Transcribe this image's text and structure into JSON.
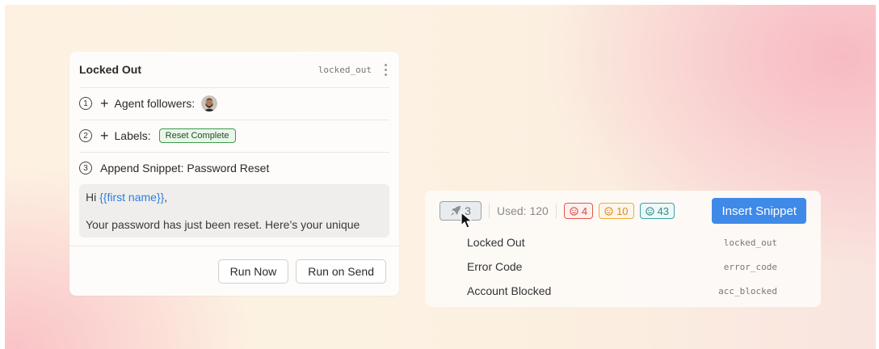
{
  "snippet_card": {
    "title": "Locked Out",
    "code": "locked_out",
    "steps": [
      {
        "num": "1",
        "text": "Agent followers:"
      },
      {
        "num": "2",
        "text": "Labels:",
        "label": "Reset Complete"
      },
      {
        "num": "3",
        "text": "Append Snippet: Password Reset"
      }
    ],
    "preview": {
      "greeting": "Hi ",
      "variable": "{{first name}}",
      "greeting_end": ",",
      "body": "Your password has just been reset. Here’s your unique"
    },
    "buttons": {
      "run_now": "Run Now",
      "run_on_send": "Run on Send"
    }
  },
  "picker": {
    "rocket_count": "3",
    "used_label": "Used: 120",
    "ratings": {
      "sad": "4",
      "neutral": "10",
      "happy": "43"
    },
    "insert_label": "Insert Snippet",
    "results": [
      {
        "name": "Locked Out",
        "code": "locked_out"
      },
      {
        "name": "Error Code",
        "code": "error_code"
      },
      {
        "name": "Account Blocked",
        "code": "acc_blocked"
      }
    ]
  },
  "colors": {
    "accent": "#3f8ae8",
    "label_green": "#3c9a4e",
    "rating_red": "#e05a4f",
    "rating_orange": "#f0a93a",
    "rating_teal": "#3aa3a3"
  },
  "icons": {
    "kebab": "kebab-menu-icon",
    "plus": "plus-icon",
    "rocket": "rocket-icon",
    "sad": "sad-face-icon",
    "neutral": "neutral-face-icon",
    "happy": "happy-face-icon",
    "cursor": "mouse-cursor-icon"
  }
}
